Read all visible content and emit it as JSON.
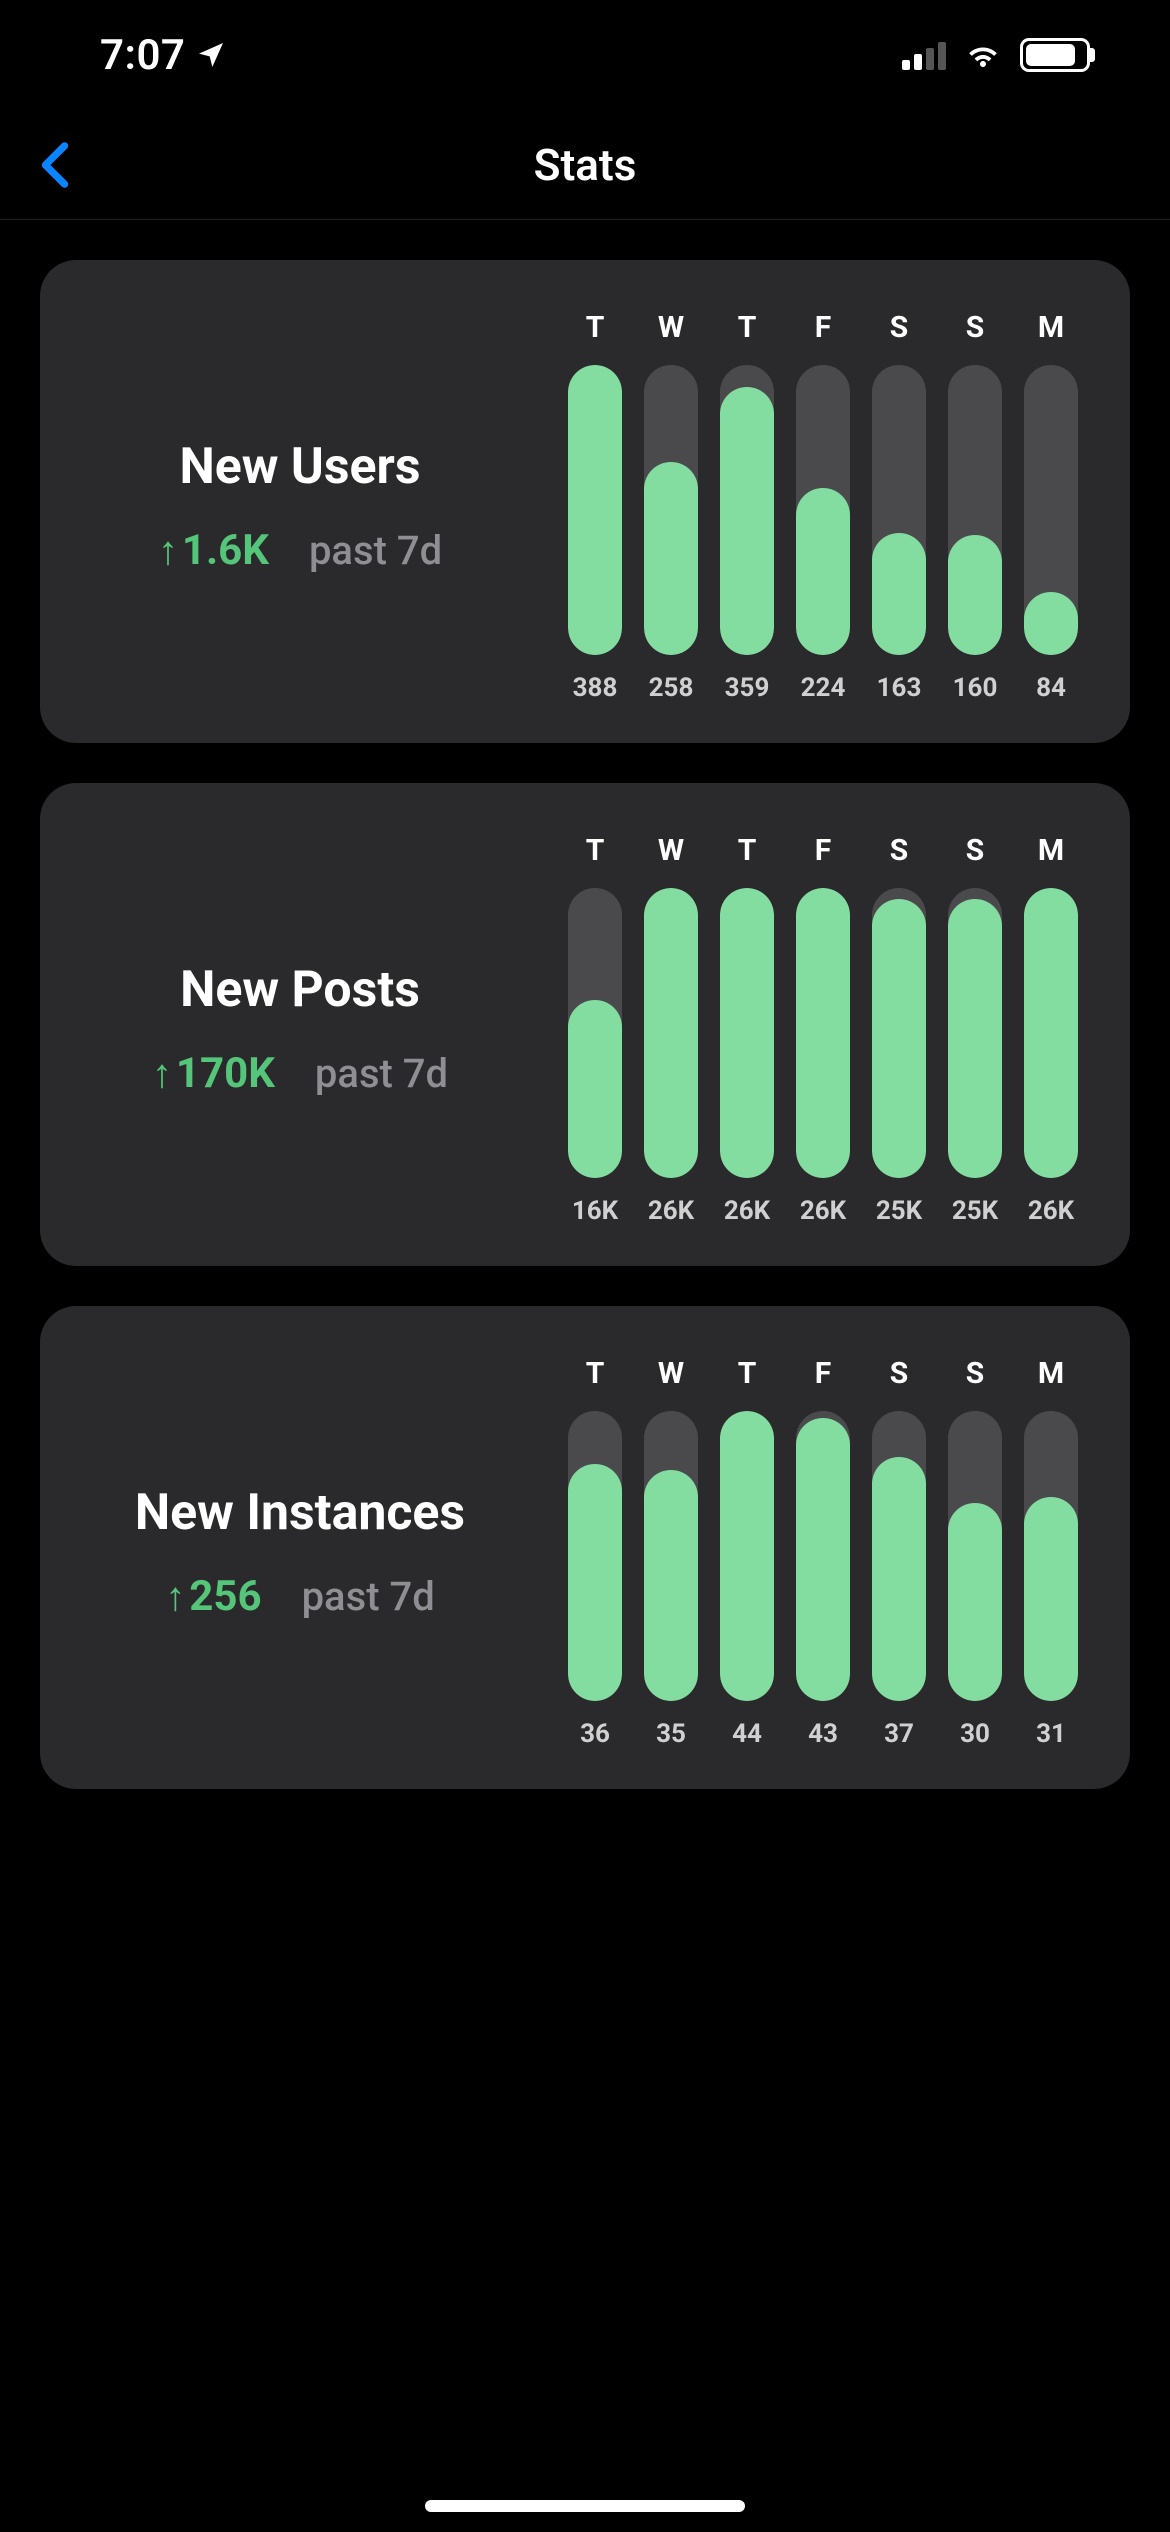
{
  "status": {
    "time": "7:07",
    "location_icon": "location-arrow",
    "cell_strength": 2,
    "wifi_icon": "wifi",
    "battery_pct": 85
  },
  "nav": {
    "title": "Stats",
    "back_icon": "chevron-left"
  },
  "cards": [
    {
      "title": "New Users",
      "metric": "1.6K",
      "direction": "up",
      "period": "past 7d",
      "days": [
        "T",
        "W",
        "T",
        "F",
        "S",
        "S",
        "M"
      ],
      "values": [
        388,
        258,
        359,
        224,
        163,
        160,
        84
      ],
      "labels": [
        "388",
        "258",
        "359",
        "224",
        "163",
        "160",
        "84"
      ]
    },
    {
      "title": "New Posts",
      "metric": "170K",
      "direction": "up",
      "period": "past 7d",
      "days": [
        "T",
        "W",
        "T",
        "F",
        "S",
        "S",
        "M"
      ],
      "values": [
        16000,
        26000,
        26000,
        26000,
        25000,
        25000,
        26000
      ],
      "labels": [
        "16K",
        "26K",
        "26K",
        "26K",
        "25K",
        "25K",
        "26K"
      ]
    },
    {
      "title": "New Instances",
      "metric": "256",
      "direction": "up",
      "period": "past 7d",
      "days": [
        "T",
        "W",
        "T",
        "F",
        "S",
        "S",
        "M"
      ],
      "values": [
        36,
        35,
        44,
        43,
        37,
        30,
        31
      ],
      "labels": [
        "36",
        "35",
        "44",
        "43",
        "37",
        "30",
        "31"
      ]
    }
  ],
  "chart_data": [
    {
      "type": "bar",
      "title": "New Users",
      "categories": [
        "T",
        "W",
        "T",
        "F",
        "S",
        "S",
        "M"
      ],
      "values": [
        388,
        258,
        359,
        224,
        163,
        160,
        84
      ],
      "xlabel": "",
      "ylabel": "",
      "ylim": [
        0,
        388
      ]
    },
    {
      "type": "bar",
      "title": "New Posts",
      "categories": [
        "T",
        "W",
        "T",
        "F",
        "S",
        "S",
        "M"
      ],
      "values": [
        16000,
        26000,
        26000,
        26000,
        25000,
        25000,
        26000
      ],
      "xlabel": "",
      "ylabel": "",
      "ylim": [
        0,
        26000
      ]
    },
    {
      "type": "bar",
      "title": "New Instances",
      "categories": [
        "T",
        "W",
        "T",
        "F",
        "S",
        "S",
        "M"
      ],
      "values": [
        36,
        35,
        44,
        43,
        37,
        30,
        31
      ],
      "xlabel": "",
      "ylabel": "",
      "ylim": [
        0,
        44
      ]
    }
  ],
  "accent_green": "#55c57a",
  "bar_green": "#83dca0"
}
